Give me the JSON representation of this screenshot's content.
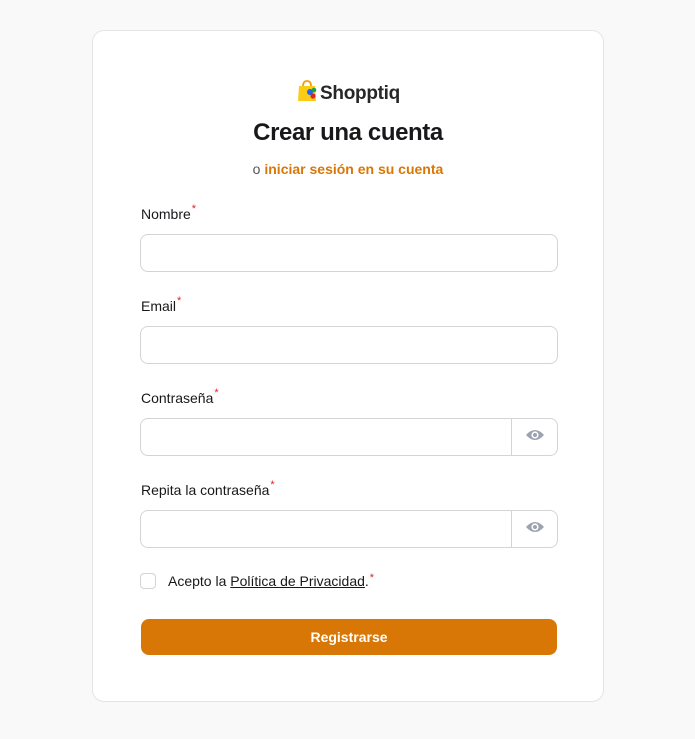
{
  "brand": {
    "name": "Shopptiq"
  },
  "heading": {
    "title": "Crear una cuenta",
    "or_text": "o",
    "login_link": "iniciar sesión en su cuenta"
  },
  "form": {
    "required_mark": "*",
    "name_label": "Nombre",
    "name_value": "",
    "email_label": "Email",
    "email_value": "",
    "password_label": "Contraseña",
    "password_value": "",
    "repeat_password_label": "Repita la contraseña",
    "repeat_password_value": "",
    "terms_prefix": "Acepto la",
    "terms_link": "Política de Privacidad",
    "terms_suffix": ".",
    "terms_checked": false,
    "submit_label": "Registrarse"
  },
  "colors": {
    "accent": "#d97706",
    "required": "#dc2626",
    "icon": "#9ca3af"
  },
  "icons": {
    "logo": "shopping-bag-logo-icon",
    "toggle_password": "eye-icon"
  }
}
